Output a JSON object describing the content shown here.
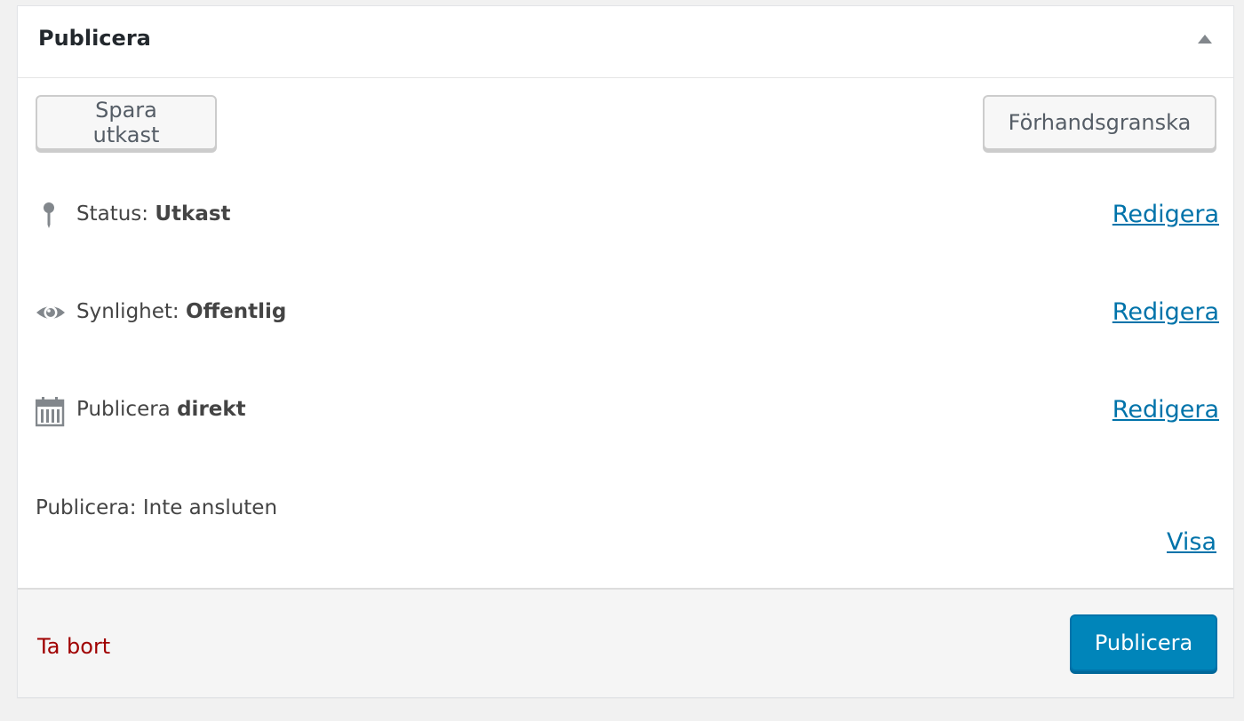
{
  "panel": {
    "title": "Publicera",
    "toggle_icon": "arrow-up-icon"
  },
  "actions": {
    "save_draft": "Spara utkast",
    "preview": "Förhandsgranska"
  },
  "status": {
    "icon": "pin-icon",
    "label": "Status:",
    "value": "Utkast",
    "edit": "Redigera"
  },
  "visibility": {
    "icon": "eye-icon",
    "label": "Synlighet:",
    "value": "Offentlig",
    "edit": "Redigera"
  },
  "schedule": {
    "icon": "calendar-icon",
    "label": "Publicera",
    "value": "direkt",
    "edit": "Redigera"
  },
  "publicize": {
    "text": "Publicera: Inte ansluten",
    "show": "Visa"
  },
  "major": {
    "delete": "Ta bort",
    "publish": "Publicera"
  },
  "colors": {
    "link": "#0073aa",
    "delete": "#a00000",
    "primary": "#0085ba"
  }
}
